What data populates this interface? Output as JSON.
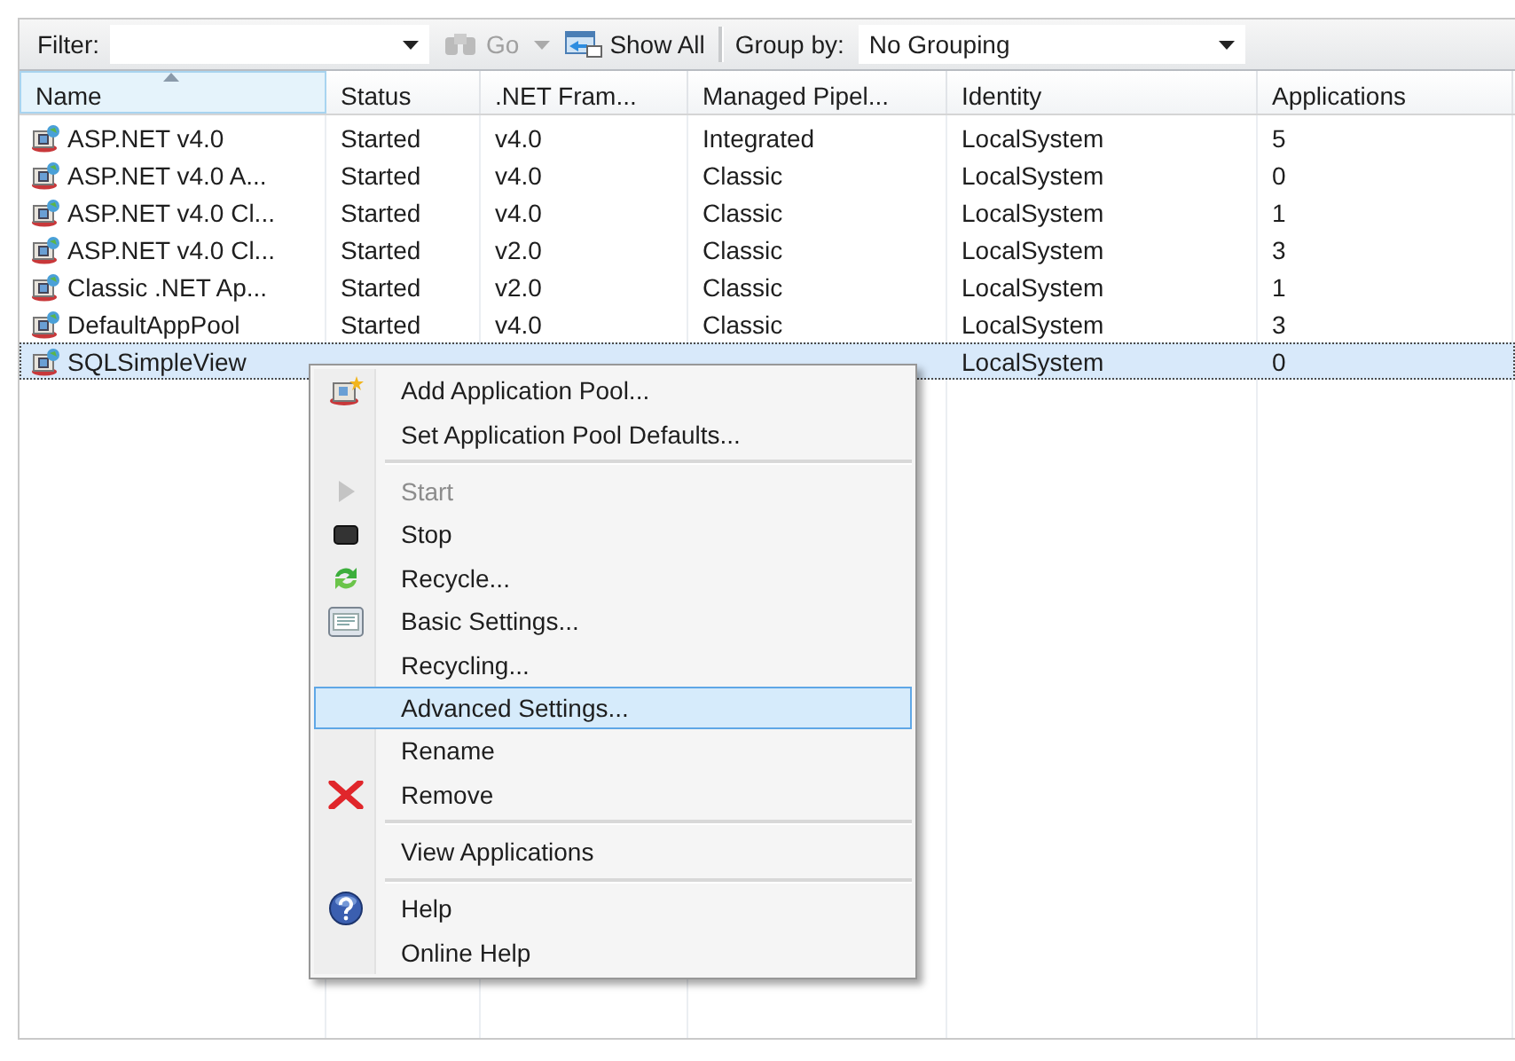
{
  "toolbar": {
    "filter_label": "Filter:",
    "go": "Go",
    "show_all": "Show All",
    "group_label": "Group by:",
    "group_value": "No Grouping"
  },
  "columns": [
    {
      "label": "Name",
      "sorted": true
    },
    {
      "label": "Status",
      "sorted": false
    },
    {
      "label": ".NET Fram...",
      "sorted": false
    },
    {
      "label": "Managed Pipel...",
      "sorted": false
    },
    {
      "label": "Identity",
      "sorted": false
    },
    {
      "label": "Applications",
      "sorted": false
    }
  ],
  "rows": [
    {
      "cells": [
        "ASP.NET v4.0",
        "Started",
        "v4.0",
        "Integrated",
        "LocalSystem",
        "5"
      ],
      "selected": false
    },
    {
      "cells": [
        "ASP.NET v4.0 A...",
        "Started",
        "v4.0",
        "Classic",
        "LocalSystem",
        "0"
      ],
      "selected": false
    },
    {
      "cells": [
        "ASP.NET v4.0 Cl...",
        "Started",
        "v4.0",
        "Classic",
        "LocalSystem",
        "1"
      ],
      "selected": false
    },
    {
      "cells": [
        "ASP.NET v4.0 Cl...",
        "Started",
        "v2.0",
        "Classic",
        "LocalSystem",
        "3"
      ],
      "selected": false
    },
    {
      "cells": [
        "Classic .NET Ap...",
        "Started",
        "v2.0",
        "Classic",
        "LocalSystem",
        "1"
      ],
      "selected": false
    },
    {
      "cells": [
        "DefaultAppPool",
        "Started",
        "v4.0",
        "Classic",
        "LocalSystem",
        "3"
      ],
      "selected": false
    },
    {
      "cells": [
        "SQLSimpleView",
        null,
        null,
        null,
        "LocalSystem",
        "0"
      ],
      "selected": true
    }
  ],
  "context_menu": [
    {
      "kind": "item",
      "label": "Add Application Pool...",
      "disabled": false,
      "selected": false
    },
    {
      "kind": "item",
      "label": "Set Application Pool Defaults...",
      "disabled": false,
      "selected": false
    },
    {
      "kind": "separator"
    },
    {
      "kind": "item",
      "label": "Start",
      "disabled": true,
      "selected": false
    },
    {
      "kind": "item",
      "label": "Stop",
      "disabled": false,
      "selected": false
    },
    {
      "kind": "item",
      "label": "Recycle...",
      "disabled": false,
      "selected": false
    },
    {
      "kind": "item",
      "label": "Basic Settings...",
      "disabled": false,
      "selected": false
    },
    {
      "kind": "item",
      "label": "Recycling...",
      "disabled": false,
      "selected": false
    },
    {
      "kind": "item",
      "label": "Advanced Settings...",
      "disabled": false,
      "selected": true
    },
    {
      "kind": "item",
      "label": "Rename",
      "disabled": false,
      "selected": false
    },
    {
      "kind": "item",
      "label": "Remove",
      "disabled": false,
      "selected": false
    },
    {
      "kind": "separator"
    },
    {
      "kind": "item",
      "label": "View Applications",
      "disabled": false,
      "selected": false
    },
    {
      "kind": "separator"
    },
    {
      "kind": "item",
      "label": "Help",
      "disabled": false,
      "selected": false
    },
    {
      "kind": "item",
      "label": "Online Help",
      "disabled": false,
      "selected": false
    }
  ]
}
